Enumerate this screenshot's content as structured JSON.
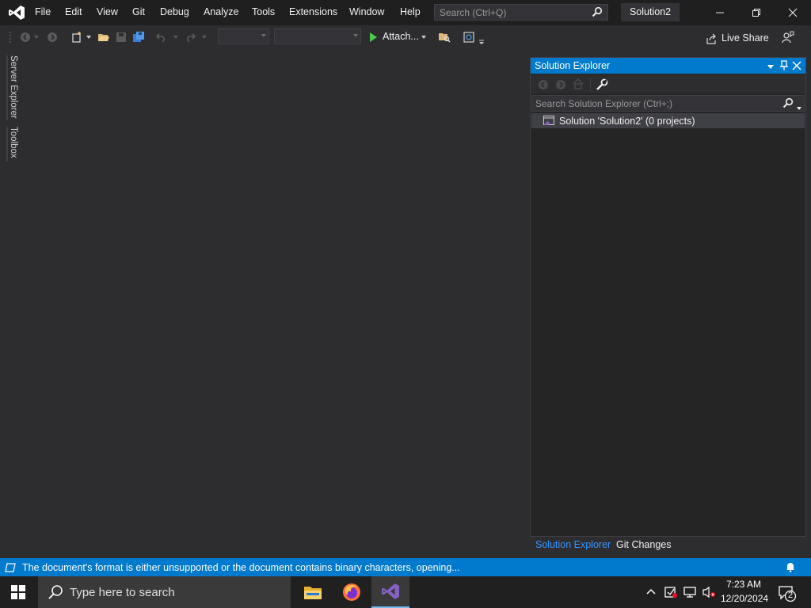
{
  "menu": [
    "File",
    "Edit",
    "View",
    "Git",
    "Debug",
    "Analyze",
    "Tools",
    "Extensions",
    "Window",
    "Help"
  ],
  "search": {
    "placeholder": "Search (Ctrl+Q)"
  },
  "solution_title": "Solution2",
  "toolbar": {
    "attach_label": "Attach...",
    "live_share_label": "Live Share"
  },
  "left_tabs": [
    "Server Explorer",
    "Toolbox"
  ],
  "solution_explorer": {
    "title": "Solution Explorer",
    "search_placeholder": "Search Solution Explorer (Ctrl+;)",
    "root_item": "Solution 'Solution2' (0 projects)",
    "tabs": [
      "Solution Explorer",
      "Git Changes"
    ]
  },
  "status": {
    "message": "The document's format is either unsupported or the document contains binary characters, opening..."
  },
  "taskbar": {
    "search_placeholder": "Type here to search",
    "time": "7:23 AM",
    "date": "12/20/2024",
    "notification_count": "2"
  },
  "colors": {
    "accent": "#007acc",
    "vs_purple": "#8661c5",
    "background": "#2d2d30",
    "titlebar": "#1f1f1f"
  }
}
